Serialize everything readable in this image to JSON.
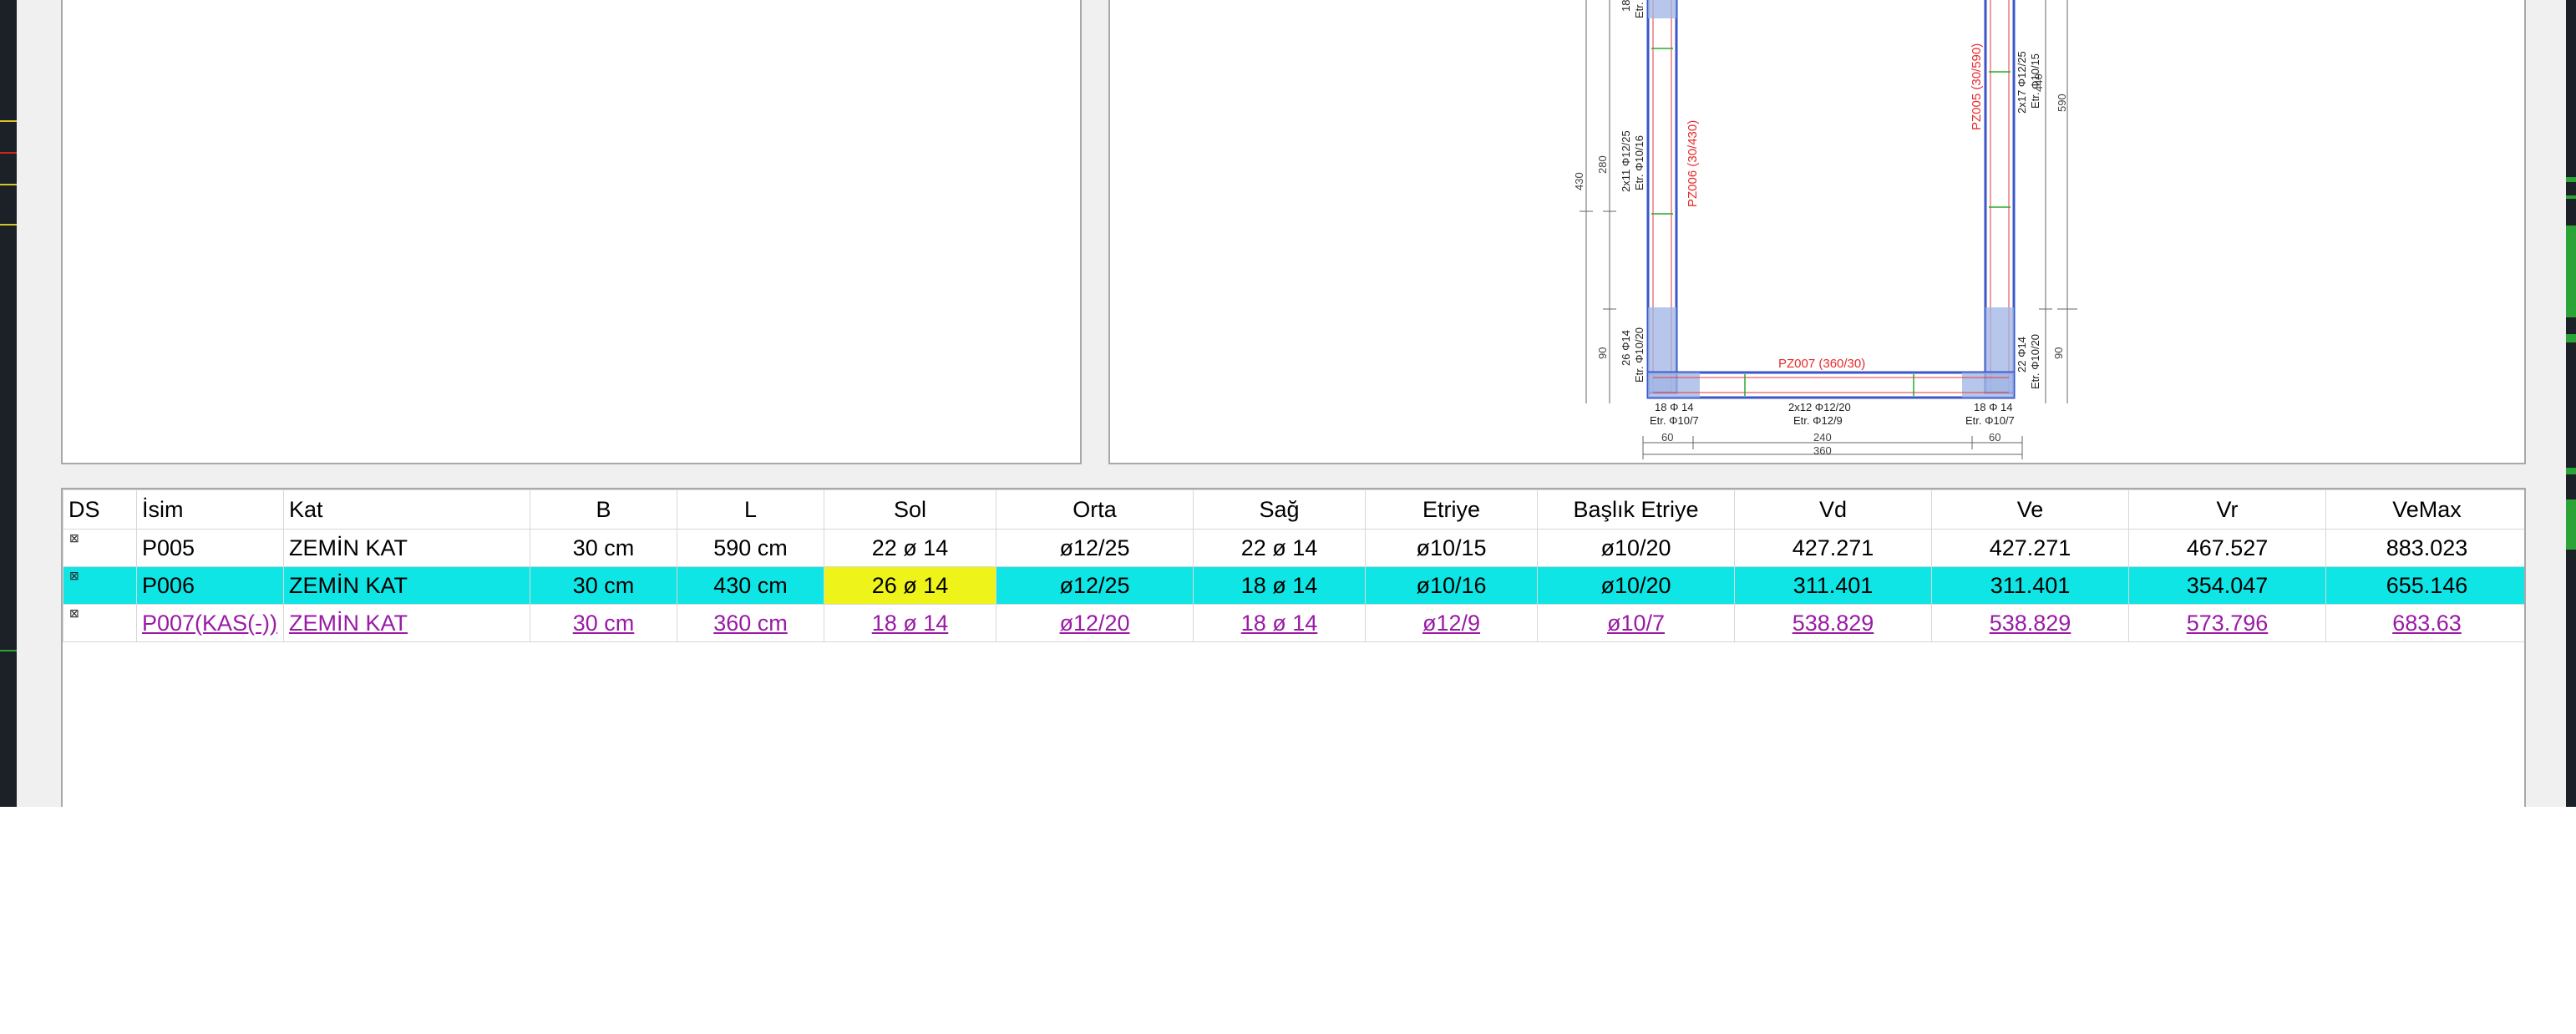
{
  "table": {
    "columns": [
      "DS",
      "İsim",
      "Kat",
      "B",
      "L",
      "Sol",
      "Orta",
      "Sağ",
      "Etriye",
      "Başlık Etriye",
      "Vd",
      "Ve",
      "Vr",
      "VeMax"
    ],
    "rows": [
      {
        "ds": "⊠",
        "isim": "P005",
        "kat": "ZEMİN KAT",
        "b": "30 cm",
        "l": "590 cm",
        "sol": "22 ø 14",
        "orta": "ø12/25",
        "sag": "22 ø 14",
        "etriye": "ø10/15",
        "baslik_etriye": "ø10/20",
        "vd": "427.271",
        "ve": "427.271",
        "vr": "467.527",
        "vemax": "883.023"
      },
      {
        "ds": "⊠",
        "isim": "P006",
        "kat": "ZEMİN KAT",
        "b": "30 cm",
        "l": "430 cm",
        "sol": "26 ø 14",
        "orta": "ø12/25",
        "sag": "18 ø 14",
        "etriye": "ø10/16",
        "baslik_etriye": "ø10/20",
        "vd": "311.401",
        "ve": "311.401",
        "vr": "354.047",
        "vemax": "655.146"
      },
      {
        "ds": "⊠",
        "isim": "P007(KAS(-))",
        "kat": "ZEMİN KAT",
        "b": "30 cm",
        "l": "360 cm",
        "sol": "18 ø 14",
        "orta": "ø12/20",
        "sag": "18 ø 14",
        "etriye": "ø12/9",
        "baslik_etriye": "ø10/7",
        "vd": "538.829",
        "ve": "538.829",
        "vr": "573.796",
        "vemax": "683.63"
      }
    ]
  },
  "drawing": {
    "labels": {
      "pz006": "PZ006 (30/430)",
      "pz005": "PZ005 (30/590)",
      "pz007": "PZ007 (360/30)",
      "left_mid_bars": "2x11 Φ12/25",
      "left_mid_etr": "Etr. Φ10/16",
      "left_low_bars": "26 Φ14",
      "left_low_etr": "Etr. Φ10/20",
      "right_top_bars": "2x17 Φ12/25",
      "right_top_etr": "Etr. Φ10/15",
      "right_low_bars": "22 Φ14",
      "right_low_etr": "Etr. Φ10/20",
      "bot_left_bars": "18 Φ 14",
      "bot_left_etr": "Etr. Φ10/7",
      "bot_mid_bars": "2x12 Φ12/20",
      "bot_mid_etr": "Etr. Φ12/9",
      "bot_right_bars": "18 Φ 14",
      "bot_right_etr": "Etr. Φ10/7",
      "top_stub": "18",
      "top_stub_etr": "Etr.",
      "dim_430": "430",
      "dim_280": "280",
      "dim_90_left": "90",
      "dim_440": "440",
      "dim_590": "590",
      "dim_90_right": "90",
      "dim_60_left": "60",
      "dim_240": "240",
      "dim_60_right": "60",
      "dim_360": "360"
    },
    "colors": {
      "outline": "#3a56c8",
      "label": "#e8292b",
      "hatch": "#9fb4e6",
      "rebar": "#e23a3a",
      "stirrup": "#2aa82a",
      "dim": "#555555"
    }
  },
  "colors": {
    "selected_row": "#10e5e5",
    "focused_cell": "#eef31a",
    "link_row": "#9a1aa6",
    "border": "#a8a8a8"
  }
}
